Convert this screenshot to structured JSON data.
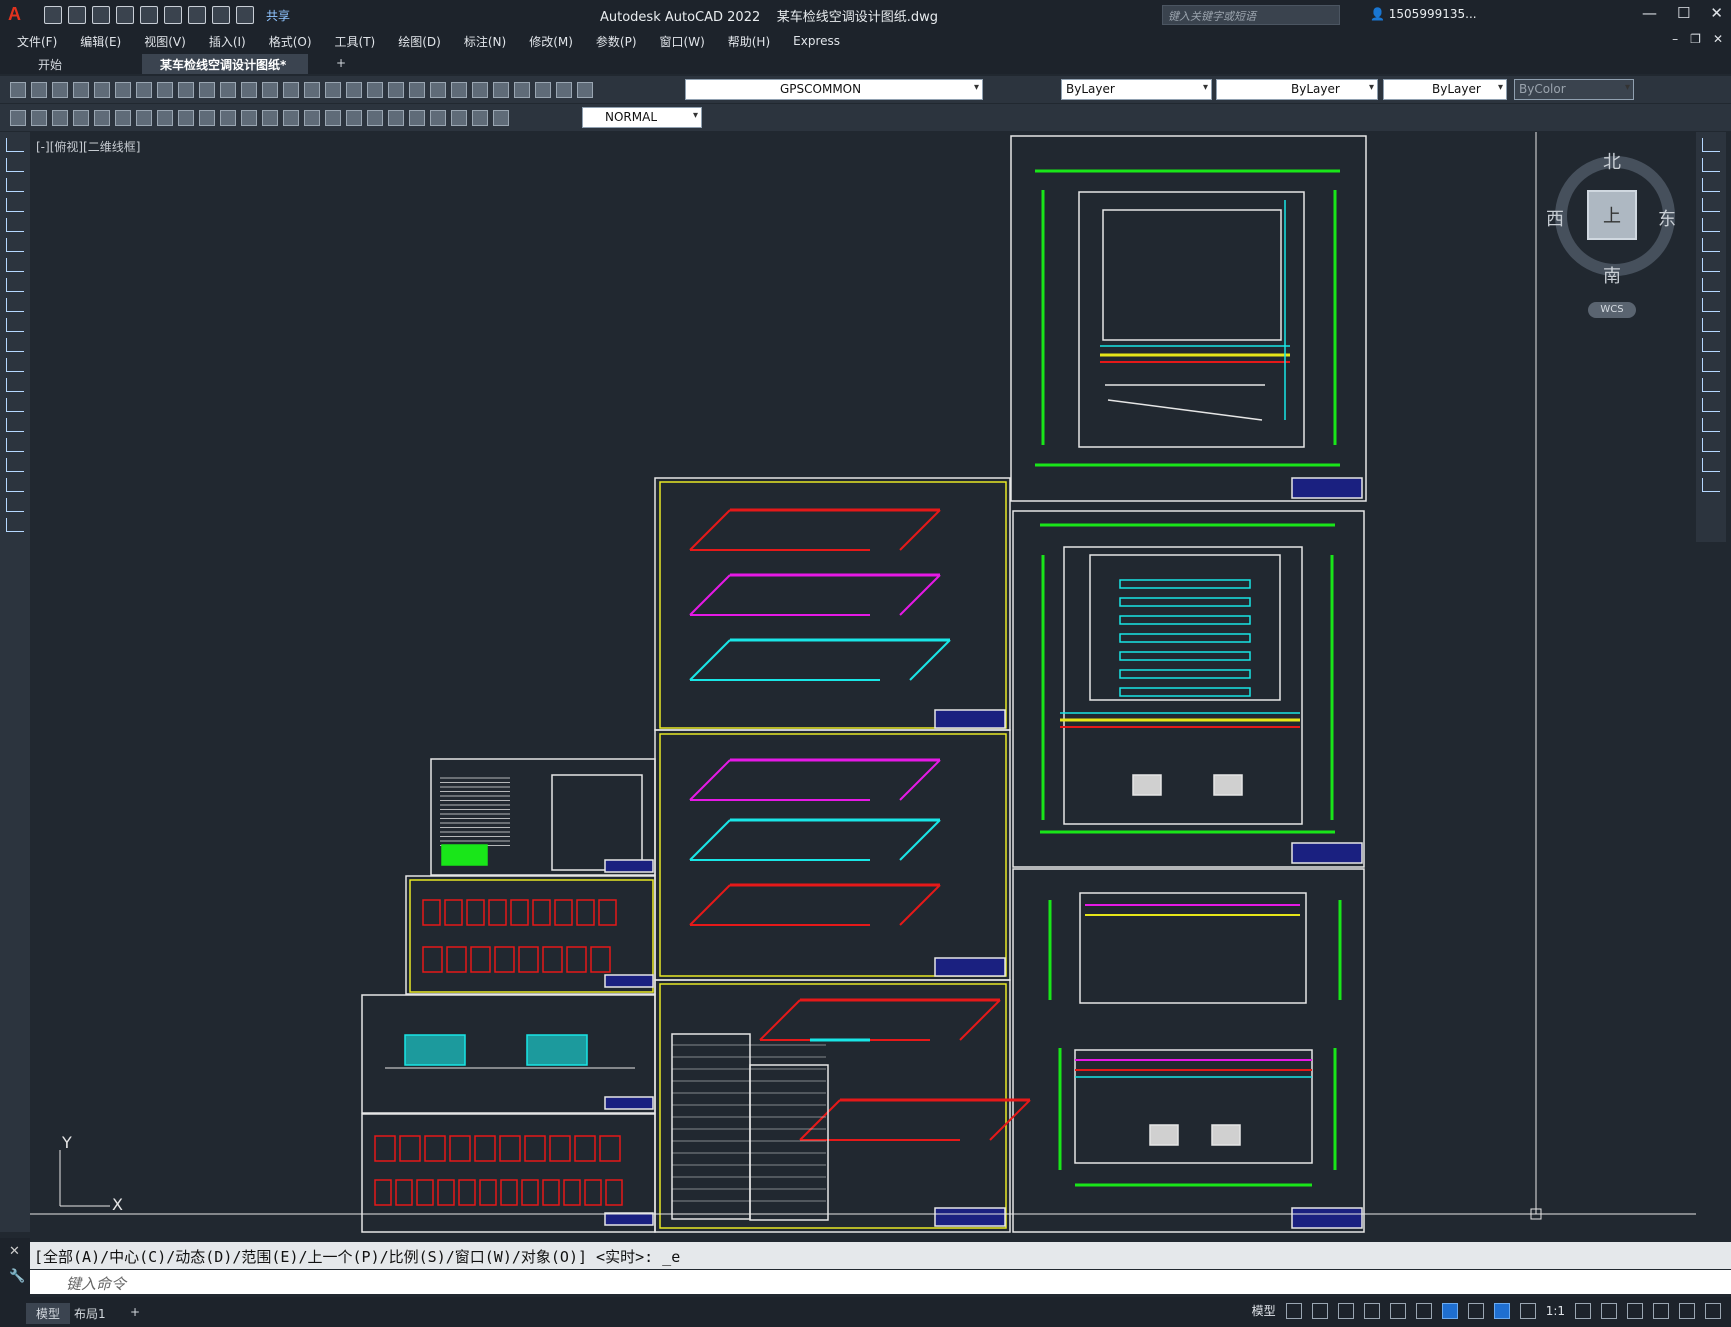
{
  "app": {
    "logo": "A",
    "title": "Autodesk AutoCAD 2022",
    "document": "某车检线空调设计图纸.dwg",
    "share_label": "共享"
  },
  "search": {
    "placeholder": "键入关键字或短语"
  },
  "user": {
    "name": "1505999135..."
  },
  "menu": [
    "文件(F)",
    "编辑(E)",
    "视图(V)",
    "插入(I)",
    "格式(O)",
    "工具(T)",
    "绘图(D)",
    "标注(N)",
    "修改(M)",
    "参数(P)",
    "窗口(W)",
    "帮助(H)",
    "Express"
  ],
  "tabs": [
    {
      "label": "开始"
    },
    {
      "label": "某车检线空调设计图纸*",
      "active": true
    }
  ],
  "toolbar": {
    "layer": "GPSCOMMON",
    "color": "ByLayer",
    "linetype": "ByLayer",
    "lineweight": "ByLayer",
    "plotstyle": "ByColor",
    "dimstyle": "NORMAL"
  },
  "viewport": {
    "label": "[-][俯视][二维线框]"
  },
  "viewcube": {
    "north": "北",
    "south": "南",
    "east": "东",
    "west": "西",
    "face": "上",
    "wcs": "WCS"
  },
  "ucs": {
    "x": "X",
    "y": "Y"
  },
  "command": {
    "history": "[全部(A)/中心(C)/动态(D)/范围(E)/上一个(P)/比例(S)/窗口(W)/对象(O)] <实时>: _e",
    "placeholder": "键入命令"
  },
  "status": {
    "tabs": [
      "模型",
      "布局1"
    ],
    "model_label": "模型",
    "scale": "1:1"
  },
  "colors": {
    "background": "#212830",
    "sheet_border": "#e6e6e6",
    "sheet_border_yellow": "#e8e826",
    "green": "#19e619",
    "cyan": "#19e6e6",
    "red": "#e61919",
    "magenta": "#e619e6",
    "yellow": "#e6e619"
  }
}
